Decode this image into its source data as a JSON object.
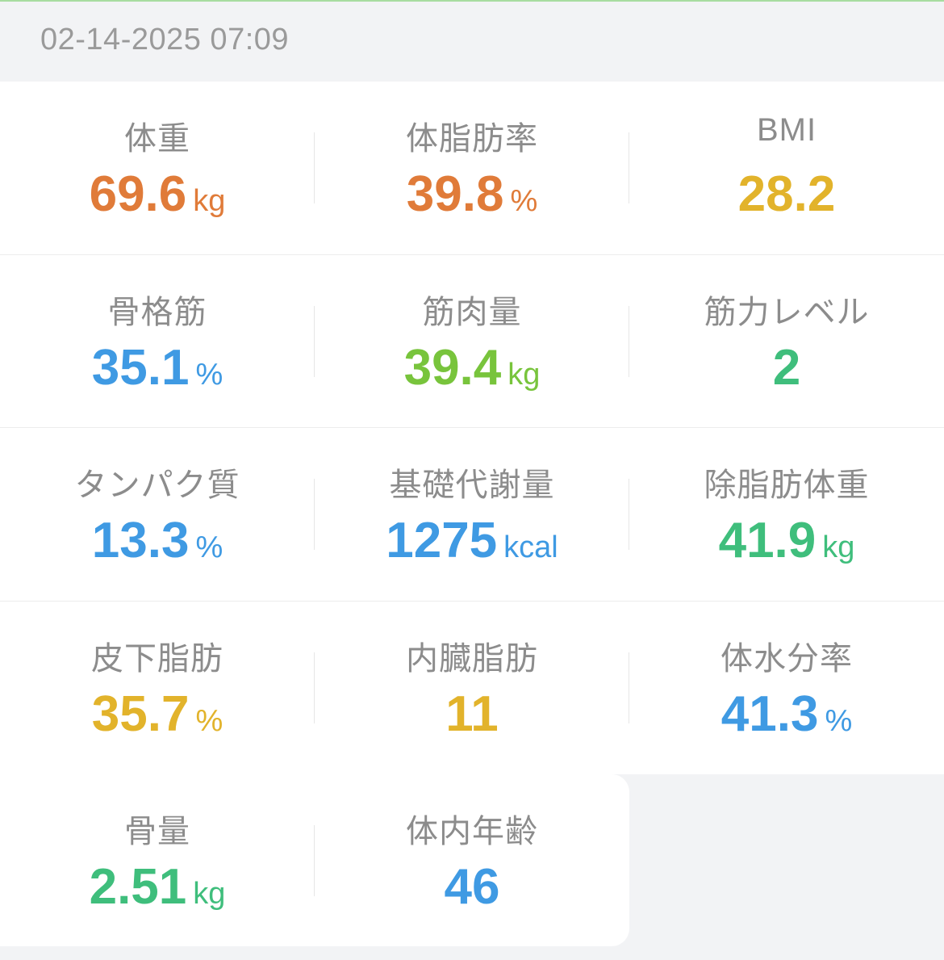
{
  "timestamp": "02-14-2025 07:09",
  "colors": {
    "orange": "#e07b39",
    "yellow": "#e2b32b",
    "blue": "#3f9ae3",
    "green_light": "#78c43c",
    "green": "#3fbe7c"
  },
  "metrics": [
    {
      "label": "体重",
      "value": "69.6",
      "unit": "kg",
      "color": "#e07b39"
    },
    {
      "label": "体脂肪率",
      "value": "39.8",
      "unit": "%",
      "color": "#e07b39"
    },
    {
      "label": "BMI",
      "value": "28.2",
      "unit": "",
      "color": "#e2b32b"
    },
    {
      "label": "骨格筋",
      "value": "35.1",
      "unit": "%",
      "color": "#3f9ae3"
    },
    {
      "label": "筋肉量",
      "value": "39.4",
      "unit": "kg",
      "color": "#78c43c"
    },
    {
      "label": "筋力レベル",
      "value": "2",
      "unit": "",
      "color": "#3fbe7c"
    },
    {
      "label": "タンパク質",
      "value": "13.3",
      "unit": "%",
      "color": "#3f9ae3"
    },
    {
      "label": "基礎代謝量",
      "value": "1275",
      "unit": "kcal",
      "color": "#3f9ae3"
    },
    {
      "label": "除脂肪体重",
      "value": "41.9",
      "unit": "kg",
      "color": "#3fbe7c"
    },
    {
      "label": "皮下脂肪",
      "value": "35.7",
      "unit": "%",
      "color": "#e2b32b"
    },
    {
      "label": "内臓脂肪",
      "value": "11",
      "unit": "",
      "color": "#e2b32b"
    },
    {
      "label": "体水分率",
      "value": "41.3",
      "unit": "%",
      "color": "#3f9ae3"
    },
    {
      "label": "骨量",
      "value": "2.51",
      "unit": "kg",
      "color": "#3fbe7c"
    },
    {
      "label": "体内年齢",
      "value": "46",
      "unit": "",
      "color": "#3f9ae3"
    }
  ]
}
